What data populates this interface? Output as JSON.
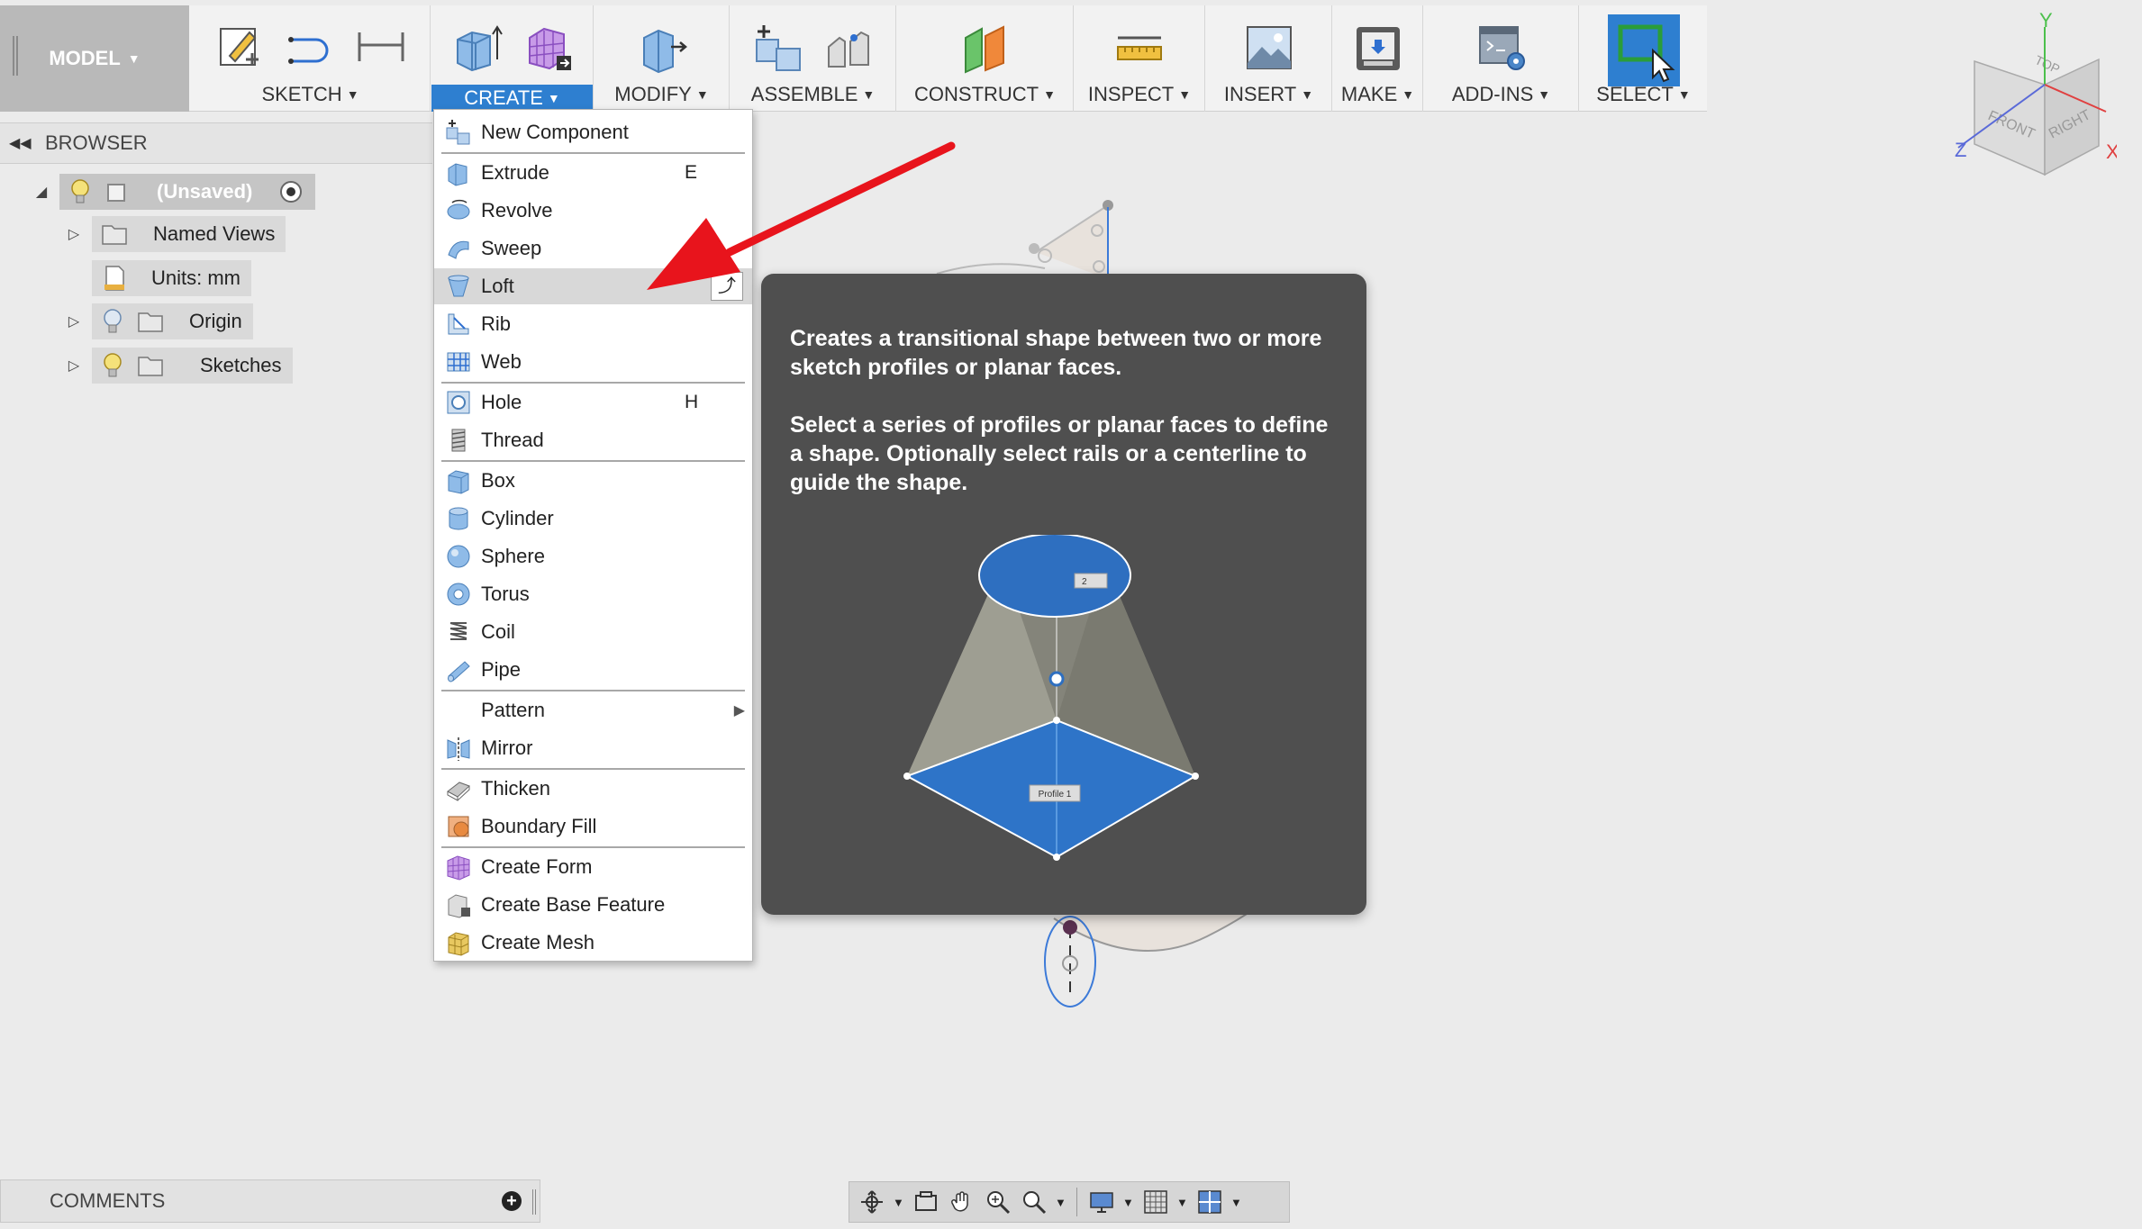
{
  "toolbar": {
    "model": "MODEL",
    "groups": [
      {
        "label": "SKETCH"
      },
      {
        "label": "CREATE"
      },
      {
        "label": "MODIFY"
      },
      {
        "label": "ASSEMBLE"
      },
      {
        "label": "CONSTRUCT"
      },
      {
        "label": "INSPECT"
      },
      {
        "label": "INSERT"
      },
      {
        "label": "MAKE"
      },
      {
        "label": "ADD-INS"
      },
      {
        "label": "SELECT"
      }
    ]
  },
  "viewcube": {
    "top": "TOP",
    "front": "FRONT",
    "right": "RIGHT",
    "x": "X",
    "y": "Y",
    "z": "Z"
  },
  "browser": {
    "title": "BROWSER",
    "root": "(Unsaved)",
    "items": [
      {
        "label": "Named Views"
      },
      {
        "label": "Units: mm"
      },
      {
        "label": "Origin"
      },
      {
        "label": "Sketches"
      }
    ]
  },
  "create_menu": {
    "items": [
      {
        "label": "New Component",
        "shortcut": ""
      },
      {
        "label": "Extrude",
        "shortcut": "E"
      },
      {
        "label": "Revolve",
        "shortcut": ""
      },
      {
        "label": "Sweep",
        "shortcut": ""
      },
      {
        "label": "Loft",
        "shortcut": ""
      },
      {
        "label": "Rib",
        "shortcut": ""
      },
      {
        "label": "Web",
        "shortcut": ""
      },
      {
        "label": "Hole",
        "shortcut": "H"
      },
      {
        "label": "Thread",
        "shortcut": ""
      },
      {
        "label": "Box",
        "shortcut": ""
      },
      {
        "label": "Cylinder",
        "shortcut": ""
      },
      {
        "label": "Sphere",
        "shortcut": ""
      },
      {
        "label": "Torus",
        "shortcut": ""
      },
      {
        "label": "Coil",
        "shortcut": ""
      },
      {
        "label": "Pipe",
        "shortcut": ""
      },
      {
        "label": "Pattern",
        "shortcut": ""
      },
      {
        "label": "Mirror",
        "shortcut": ""
      },
      {
        "label": "Thicken",
        "shortcut": ""
      },
      {
        "label": "Boundary Fill",
        "shortcut": ""
      },
      {
        "label": "Create Form",
        "shortcut": ""
      },
      {
        "label": "Create Base Feature",
        "shortcut": ""
      },
      {
        "label": "Create Mesh",
        "shortcut": ""
      }
    ]
  },
  "tooltip": {
    "para1": "Creates a transitional shape between two or more sketch profiles or planar faces.",
    "para2": "Select a series of profiles or planar faces to define a shape. Optionally select rails or a centerline to guide the shape.",
    "profile_label": "Profile 1",
    "profile_label_2": "2"
  },
  "comments": {
    "title": "COMMENTS"
  },
  "colors": {
    "accent": "#2e7fd0",
    "arrow": "#e8141c",
    "tooltip_bg": "#4f4f4f"
  }
}
